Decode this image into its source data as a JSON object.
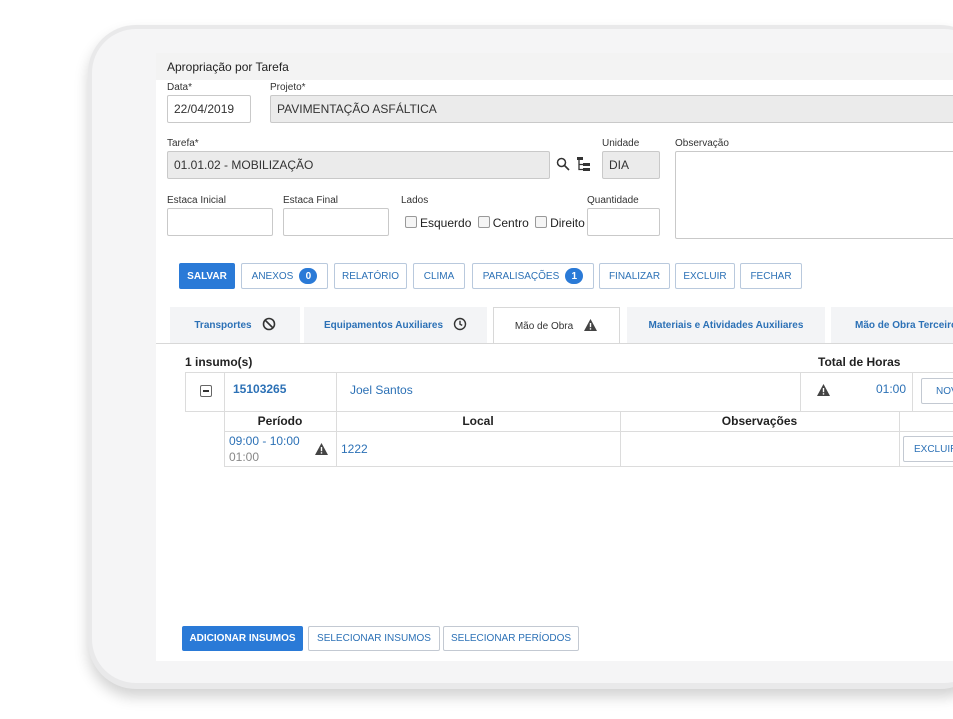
{
  "form": {
    "title": "Apropriação por Tarefa",
    "data_label": "Data*",
    "data_value": "22/04/2019",
    "projeto_label": "Projeto*",
    "projeto_value": "PAVIMENTAÇÃO ASFÁLTICA",
    "tarefa_label": "Tarefa*",
    "tarefa_value": "01.01.02 - MOBILIZAÇÃO",
    "unidade_label": "Unidade",
    "unidade_value": "DIA",
    "observacao_label": "Observação",
    "observacao_value": "",
    "estaca_inicial_label": "Estaca Inicial",
    "estaca_inicial_value": "",
    "estaca_final_label": "Estaca Final",
    "estaca_final_value": "",
    "lados_label": "Lados",
    "lados_options": [
      "Esquerdo",
      "Centro",
      "Direito"
    ],
    "quantidade_label": "Quantidade",
    "quantidade_value": ""
  },
  "toolbar": {
    "salvar": "SALVAR",
    "anexos": "ANEXOS",
    "anexos_count": "0",
    "relatorio": "RELATÓRIO",
    "clima": "CLIMA",
    "paralisacoes": "PARALISAÇÕES",
    "paralisacoes_count": "1",
    "finalizar": "FINALIZAR",
    "excluir": "EXCLUIR",
    "fechar": "FECHAR"
  },
  "tabs": [
    {
      "label": "Transportes",
      "icon": "ban-icon"
    },
    {
      "label": "Equipamentos Auxiliares",
      "icon": "clock-icon"
    },
    {
      "label": "Mão de Obra",
      "icon": "warning-icon"
    },
    {
      "label": "Materiais e Atividades Auxiliares",
      "icon": ""
    },
    {
      "label": "Mão de Obra Terceiro",
      "icon": ""
    }
  ],
  "insumos": {
    "count_label": "1 insumo(s)",
    "total_horas_label": "Total de Horas",
    "row": {
      "code": "15103265",
      "name": "Joel Santos",
      "total": "01:00",
      "novo_button": "NOVO"
    },
    "periods_header": {
      "periodo": "Período",
      "local": "Local",
      "observacoes": "Observações"
    },
    "period_row": {
      "range": "09:00 - 10:00",
      "duration": "01:00",
      "local": "1222",
      "observacoes": "",
      "excluir_button": "EXCLUIR"
    }
  },
  "footer": {
    "adicionar": "ADICIONAR INSUMOS",
    "selecionar_insumos": "SELECIONAR INSUMOS",
    "selecionar_periodos": "SELECIONAR PERÍODOS"
  },
  "colors": {
    "accent": "#2a7ad7",
    "link": "#2c71b6"
  }
}
